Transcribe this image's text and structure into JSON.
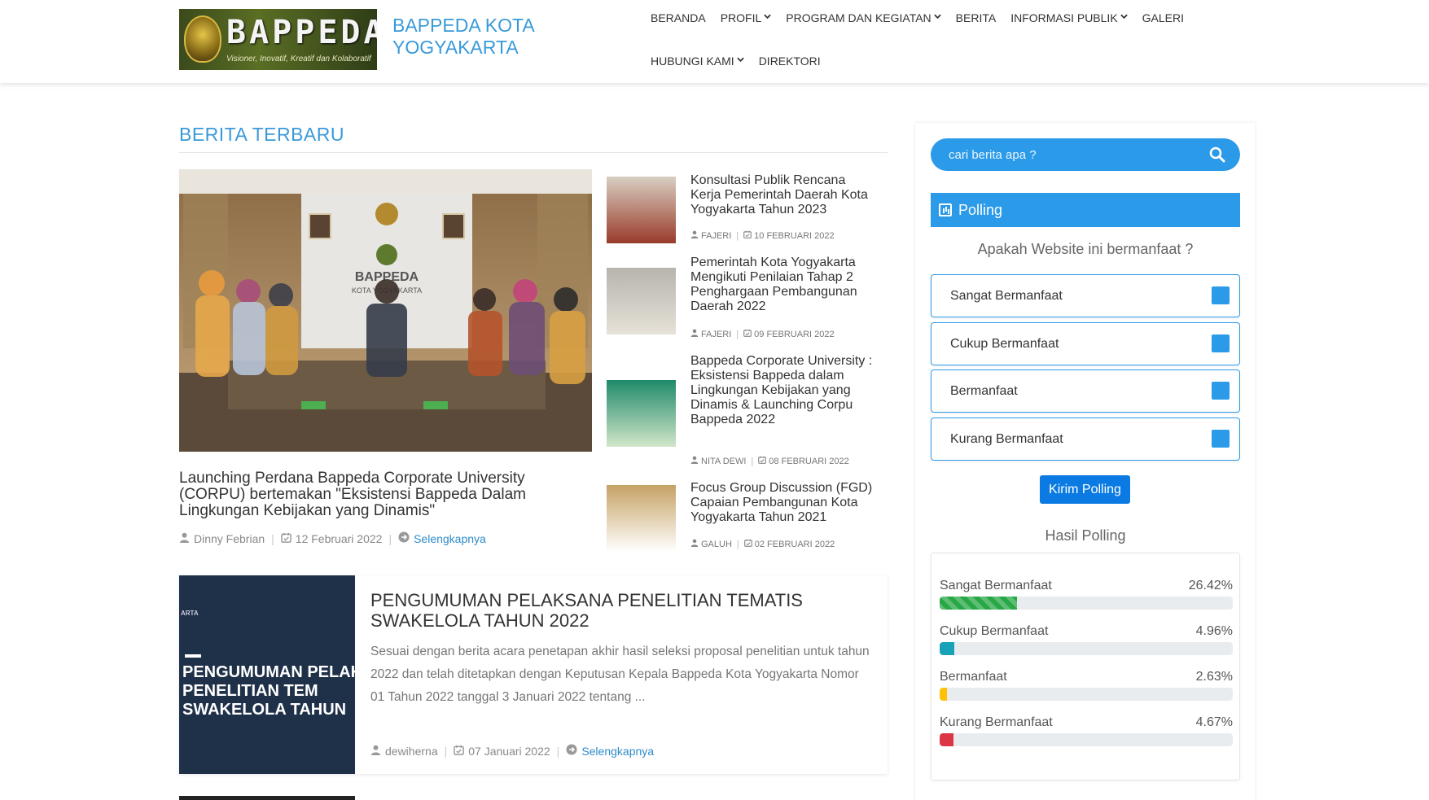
{
  "site": {
    "logo_text": "BAPPEDA",
    "logo_tagline": "Visioner, Inovatif, Kreatif dan Kolaboratif",
    "name": "BAPPEDA KOTA YOGYAKARTA"
  },
  "nav": {
    "row1": [
      {
        "label": "BERANDA",
        "dropdown": false
      },
      {
        "label": "PROFIL",
        "dropdown": true
      },
      {
        "label": "PROGRAM DAN KEGIATAN",
        "dropdown": true
      },
      {
        "label": "BERITA",
        "dropdown": false
      },
      {
        "label": "INFORMASI PUBLIK",
        "dropdown": true
      },
      {
        "label": "GALERI",
        "dropdown": false
      }
    ],
    "row2": [
      {
        "label": "HUBUNGI KAMI",
        "dropdown": true
      },
      {
        "label": "DIREKTORI",
        "dropdown": false
      }
    ]
  },
  "main": {
    "section_title": "BERITA TERBARU",
    "featured": {
      "title": "Launching Perdana Bappeda Corporate University (CORPU) bertemakan \"Eksistensi Bappeda Dalam Lingkungan Kebijakan yang Dinamis\"",
      "author": "Dinny Febrian",
      "date": "12 Februari 2022",
      "more": "Selengkapnya",
      "photo_sign": "BAPPEDA",
      "photo_sign2": "KOTA YOGYAKARTA"
    },
    "side_news": [
      {
        "title": "Konsultasi Publik Rencana Kerja Pemerintah Daerah Kota Yogyakarta Tahun 2023",
        "author": "FAJERI",
        "date": "10 FEBRUARI 2022"
      },
      {
        "title": "Pemerintah Kota Yogyakarta Mengikuti Penilaian Tahap 2 Penghargaan Pembangunan Daerah 2022",
        "author": "FAJERI",
        "date": "09 FEBRUARI 2022"
      },
      {
        "title": "Bappeda Corporate University : Eksistensi Bappeda dalam Lingkungan Kebijakan yang Dinamis & Launching Corpu Bappeda 2022",
        "author": "NITA DEWI",
        "date": "08 FEBRUARI 2022"
      },
      {
        "title": "Focus Group Discussion (FGD) Capaian Pembangunan Kota Yogyakarta Tahun 2021",
        "author": "GALUH",
        "date": "02 FEBRUARI 2022"
      }
    ],
    "announcement": {
      "title": "PENGUMUMAN PELAKSANA PENELITIAN TEMATIS SWAKELOLA TAHUN 2022",
      "excerpt": "Sesuai dengan berita acara penetapan akhir hasil seleksi proposal penelitian untuk tahun 2022 dan telah ditetapkan dengan Keputusan Kepala Bappeda Kota Yogyakarta Nomor 01 Tahun 2022 tanggal 3 Januari 2022 tentang ...",
      "author": "dewiherna",
      "date": "07 Januari 2022",
      "more": "Selengkapnya",
      "image_top": "ARTA",
      "image_lines": [
        "PENGUMUMAN PELAK",
        "PENELITIAN TEM",
        "SWAKELOLA TAHUN"
      ]
    }
  },
  "sidebar": {
    "search_placeholder": "cari berita apa ?",
    "poll_heading": "Polling",
    "poll_question": "Apakah Website ini bermanfaat ?",
    "options": [
      "Sangat Bermanfaat",
      "Cukup Bermanfaat",
      "Bermanfaat",
      "Kurang Bermanfaat"
    ],
    "submit_label": "Kirim Polling",
    "results_title": "Hasil Polling",
    "results": [
      {
        "label": "Sangat Bermanfaat",
        "value": "26.42%",
        "percent": 26.42,
        "color": "#28a745",
        "striped": true
      },
      {
        "label": "Cukup Bermanfaat",
        "value": "4.96%",
        "percent": 4.96,
        "color": "#17a2b8",
        "striped": false
      },
      {
        "label": "Bermanfaat",
        "value": "2.63%",
        "percent": 2.63,
        "color": "#ffc107",
        "striped": false
      },
      {
        "label": "Kurang Bermanfaat",
        "value": "4.67%",
        "percent": 4.67,
        "color": "#dc3545",
        "striped": false
      }
    ]
  },
  "colors": {
    "accent": "#2b9ae8",
    "link": "#2e8bc9",
    "title": "#3a9ad9"
  }
}
